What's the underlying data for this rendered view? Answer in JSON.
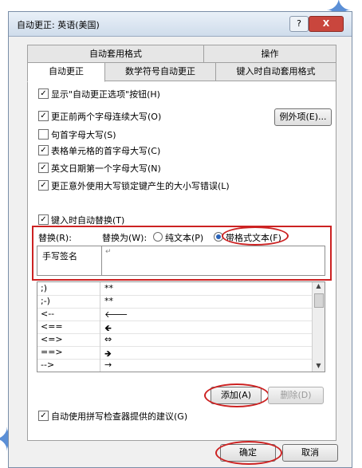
{
  "window": {
    "title": "自动更正: 英语(美国)",
    "help_label": "?",
    "close_label": "X"
  },
  "tabs_top": [
    "自动套用格式",
    "操作"
  ],
  "tabs_bottom": [
    "自动更正",
    "数学符号自动更正",
    "键入时自动套用格式"
  ],
  "options": [
    {
      "label": "显示\"自动更正选项\"按钮(H)",
      "checked": true
    },
    {
      "label": "更正前两个字母连续大写(O)",
      "checked": true
    },
    {
      "label": "句首字母大写(S)",
      "checked": false
    },
    {
      "label": "表格单元格的首字母大写(C)",
      "checked": true
    },
    {
      "label": "英文日期第一个字母大写(N)",
      "checked": true
    },
    {
      "label": "更正意外使用大写锁定键产生的大小写错误(L)",
      "checked": true
    }
  ],
  "exceptions_button": "例外项(E)...",
  "replace_as_you_type": {
    "label": "键入时自动替换(T)",
    "checked": true
  },
  "replace_label": "替换(R):",
  "with_label": "替换为(W):",
  "plain_text_label": "纯文本(P)",
  "formatted_text_label": "带格式文本(F)",
  "replace_value": "手写签名",
  "with_value": "↵",
  "entries": [
    {
      "from": ";)",
      "to": "**"
    },
    {
      "from": ";-)",
      "to": "**"
    },
    {
      "from": "<--",
      "to": "🡐"
    },
    {
      "from": "<==",
      "to": "🡸"
    },
    {
      "from": "<=>",
      "to": "⇔"
    },
    {
      "from": "==>",
      "to": "🡺"
    },
    {
      "from": "-->",
      "to": "→"
    }
  ],
  "add_button": "添加(A)",
  "delete_button": "删除(D)",
  "spellcheck": {
    "label": "自动使用拼写检查器提供的建议(G)",
    "checked": true
  },
  "ok_button": "确定",
  "cancel_button": "取消",
  "colors": {
    "highlight": "#cc2222",
    "accent": "#2a63b8"
  }
}
